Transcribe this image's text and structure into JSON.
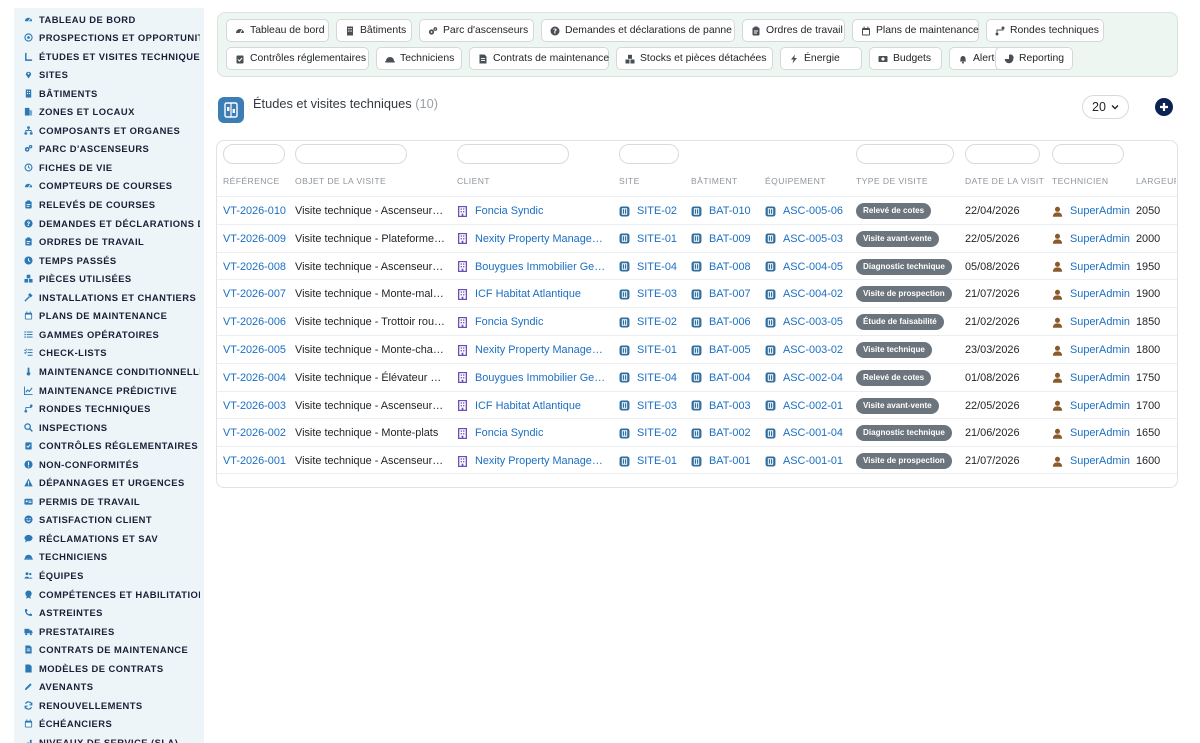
{
  "sidebar": {
    "items": [
      {
        "label": "TABLEAU DE BORD",
        "icon": "gauge-icon"
      },
      {
        "label": "PROSPECTIONS ET OPPORTUNITÉS",
        "icon": "target-icon"
      },
      {
        "label": "ÉTUDES ET VISITES TECHNIQUES",
        "icon": "ruler-icon"
      },
      {
        "label": "SITES",
        "icon": "map-pin-icon"
      },
      {
        "label": "BÂTIMENTS",
        "icon": "building-icon"
      },
      {
        "label": "ZONES ET LOCAUX",
        "icon": "door-icon"
      },
      {
        "label": "COMPOSANTS ET ORGANES",
        "icon": "sitemap-icon"
      },
      {
        "label": "PARC D'ASCENSEURS",
        "icon": "gears-icon"
      },
      {
        "label": "FICHES DE VIE",
        "icon": "history-icon"
      },
      {
        "label": "COMPTEURS DE COURSES",
        "icon": "gauge-icon"
      },
      {
        "label": "RELEVÉS DE COURSES",
        "icon": "clipboard-icon"
      },
      {
        "label": "DEMANDES ET DÉCLARATIONS DE PANNE",
        "icon": "question-icon"
      },
      {
        "label": "ORDRES DE TRAVAIL",
        "icon": "clipboard-icon"
      },
      {
        "label": "TEMPS PASSÉS",
        "icon": "clock-icon"
      },
      {
        "label": "PIÈCES UTILISÉES",
        "icon": "boxes-icon"
      },
      {
        "label": "INSTALLATIONS ET CHANTIERS",
        "icon": "hammer-icon"
      },
      {
        "label": "PLANS DE MAINTENANCE",
        "icon": "calendar-icon"
      },
      {
        "label": "GAMMES OPÉRATOIRES",
        "icon": "list-icon"
      },
      {
        "label": "CHECK-LISTS",
        "icon": "checklist-icon"
      },
      {
        "label": "MAINTENANCE CONDITIONNELLE",
        "icon": "thermometer-icon"
      },
      {
        "label": "MAINTENANCE PRÉDICTIVE",
        "icon": "chart-icon"
      },
      {
        "label": "RONDES TECHNIQUES",
        "icon": "route-icon"
      },
      {
        "label": "INSPECTIONS",
        "icon": "search-icon"
      },
      {
        "label": "CONTRÔLES RÉGLEMENTAIRES",
        "icon": "clipboard-check-icon"
      },
      {
        "label": "NON-CONFORMITÉS",
        "icon": "exclamation-icon"
      },
      {
        "label": "DÉPANNAGES ET URGENCES",
        "icon": "warning-icon"
      },
      {
        "label": "PERMIS DE TRAVAIL",
        "icon": "id-card-icon"
      },
      {
        "label": "SATISFACTION CLIENT",
        "icon": "smile-icon"
      },
      {
        "label": "RÉCLAMATIONS ET SAV",
        "icon": "comment-icon"
      },
      {
        "label": "TECHNICIENS",
        "icon": "hard-hat-icon"
      },
      {
        "label": "ÉQUIPES",
        "icon": "users-icon"
      },
      {
        "label": "COMPÉTENCES ET HABILITATIONS",
        "icon": "certificate-icon"
      },
      {
        "label": "ASTREINTES",
        "icon": "phone-icon"
      },
      {
        "label": "PRESTATAIRES",
        "icon": "truck-icon"
      },
      {
        "label": "CONTRATS DE MAINTENANCE",
        "icon": "file-contract-icon"
      },
      {
        "label": "MODÈLES DE CONTRATS",
        "icon": "file-icon"
      },
      {
        "label": "AVENANTS",
        "icon": "pen-icon"
      },
      {
        "label": "RENOUVELLEMENTS",
        "icon": "sync-icon"
      },
      {
        "label": "ÉCHÉANCIERS",
        "icon": "calendar-icon"
      },
      {
        "label": "NIVEAUX DE SERVICE (SLA)",
        "icon": "signal-icon"
      }
    ]
  },
  "topnav": {
    "row1": [
      {
        "label": "Tableau de bord",
        "icon": "gauge-icon"
      },
      {
        "label": "Bâtiments",
        "icon": "building-icon"
      },
      {
        "label": "Parc d'ascenseurs",
        "icon": "gears-icon"
      },
      {
        "label": "Demandes et déclarations de panne",
        "icon": "question-icon"
      },
      {
        "label": "Ordres de travail",
        "icon": "clipboard-icon"
      },
      {
        "label": "Plans de maintenance",
        "icon": "calendar-icon"
      },
      {
        "label": "Rondes techniques",
        "icon": "route-icon"
      }
    ],
    "row2": [
      {
        "label": "Contrôles réglementaires",
        "icon": "clipboard-check-icon"
      },
      {
        "label": "Techniciens",
        "icon": "hard-hat-icon"
      },
      {
        "label": "Contrats de maintenance",
        "icon": "file-contract-icon"
      },
      {
        "label": "Stocks et pièces détachées",
        "icon": "boxes-icon"
      },
      {
        "label": "Énergie",
        "icon": "bolt-icon"
      },
      {
        "label": "Budgets",
        "icon": "money-icon"
      },
      {
        "label": "Alertes",
        "icon": "bell-icon"
      },
      {
        "label": "Reporting",
        "icon": "pie-icon"
      }
    ]
  },
  "header": {
    "title": "Études et visites techniques",
    "count": "(10)",
    "page_size": "20"
  },
  "table": {
    "columns": [
      "RÉFÉRENCE",
      "OBJET DE LA VISITE",
      "CLIENT",
      "SITE",
      "BÂTIMENT",
      "ÉQUIPEMENT",
      "TYPE DE VISITE",
      "DATE DE LA VISITE",
      "TECHNICIEN",
      "LARGEUR"
    ],
    "rows": [
      {
        "ref": "VT-2026-010",
        "objet": "Visite technique - Ascenseur Bâtiment",
        "client": "Foncia Syndic",
        "site": "SITE-02",
        "batiment": "BAT-010",
        "equipement": "ASC-005-06",
        "type": "Relevé de cotes",
        "date": "22/04/2026",
        "technicien": "SuperAdmin",
        "largeur": "2050"
      },
      {
        "ref": "VT-2026-009",
        "objet": "Visite technique - Plateforme élévatrice",
        "client": "Nexity Property Management",
        "site": "SITE-01",
        "batiment": "BAT-009",
        "equipement": "ASC-005-03",
        "type": "Visite avant-vente",
        "date": "22/05/2026",
        "technicien": "SuperAdmin",
        "largeur": "2000"
      },
      {
        "ref": "VT-2026-008",
        "objet": "Visite technique - Ascenseur Bâtiment",
        "client": "Bouygues Immobilier Gestion",
        "site": "SITE-04",
        "batiment": "BAT-008",
        "equipement": "ASC-004-05",
        "type": "Diagnostic technique",
        "date": "05/08/2026",
        "technicien": "SuperAdmin",
        "largeur": "1950"
      },
      {
        "ref": "VT-2026-007",
        "objet": "Visite technique - Monte-malades",
        "client": "ICF Habitat Atlantique",
        "site": "SITE-03",
        "batiment": "BAT-007",
        "equipement": "ASC-004-02",
        "type": "Visite de prospection",
        "date": "21/07/2026",
        "technicien": "SuperAdmin",
        "largeur": "1900"
      },
      {
        "ref": "VT-2026-006",
        "objet": "Visite technique - Trottoir roulant",
        "client": "Foncia Syndic",
        "site": "SITE-02",
        "batiment": "BAT-006",
        "equipement": "ASC-003-05",
        "type": "Étude de faisabilité",
        "date": "21/02/2026",
        "technicien": "SuperAdmin",
        "largeur": "1850"
      },
      {
        "ref": "VT-2026-005",
        "objet": "Visite technique - Monte-charge",
        "client": "Nexity Property Management",
        "site": "SITE-01",
        "batiment": "BAT-005",
        "equipement": "ASC-003-02",
        "type": "Visite technique",
        "date": "23/03/2026",
        "technicien": "SuperAdmin",
        "largeur": "1800"
      },
      {
        "ref": "VT-2026-004",
        "objet": "Visite technique - Élévateur PMR",
        "client": "Bouygues Immobilier Gestion",
        "site": "SITE-04",
        "batiment": "BAT-004",
        "equipement": "ASC-002-04",
        "type": "Relevé de cotes",
        "date": "01/08/2026",
        "technicien": "SuperAdmin",
        "largeur": "1750"
      },
      {
        "ref": "VT-2026-003",
        "objet": "Visite technique - Ascenseur Bâtiment",
        "client": "ICF Habitat Atlantique",
        "site": "SITE-03",
        "batiment": "BAT-003",
        "equipement": "ASC-002-01",
        "type": "Visite avant-vente",
        "date": "22/05/2026",
        "technicien": "SuperAdmin",
        "largeur": "1700"
      },
      {
        "ref": "VT-2026-002",
        "objet": "Visite technique - Monte-plats",
        "client": "Foncia Syndic",
        "site": "SITE-02",
        "batiment": "BAT-002",
        "equipement": "ASC-001-04",
        "type": "Diagnostic technique",
        "date": "21/06/2026",
        "technicien": "SuperAdmin",
        "largeur": "1650"
      },
      {
        "ref": "VT-2026-001",
        "objet": "Visite technique - Ascenseur Bâtiment",
        "client": "Nexity Property Management",
        "site": "SITE-01",
        "batiment": "BAT-001",
        "equipement": "ASC-001-01",
        "type": "Visite de prospection",
        "date": "21/07/2026",
        "technicien": "SuperAdmin",
        "largeur": "1600"
      }
    ]
  },
  "colors": {
    "link": "#1b6fc2",
    "sidebar_icon": "#2a78b5",
    "badge": "#6c757d",
    "add_button": "#0c2252",
    "client_icon": "#6c4fb3",
    "entity_icon": "#2f6e9e",
    "user_icon": "#8a5a2b"
  }
}
